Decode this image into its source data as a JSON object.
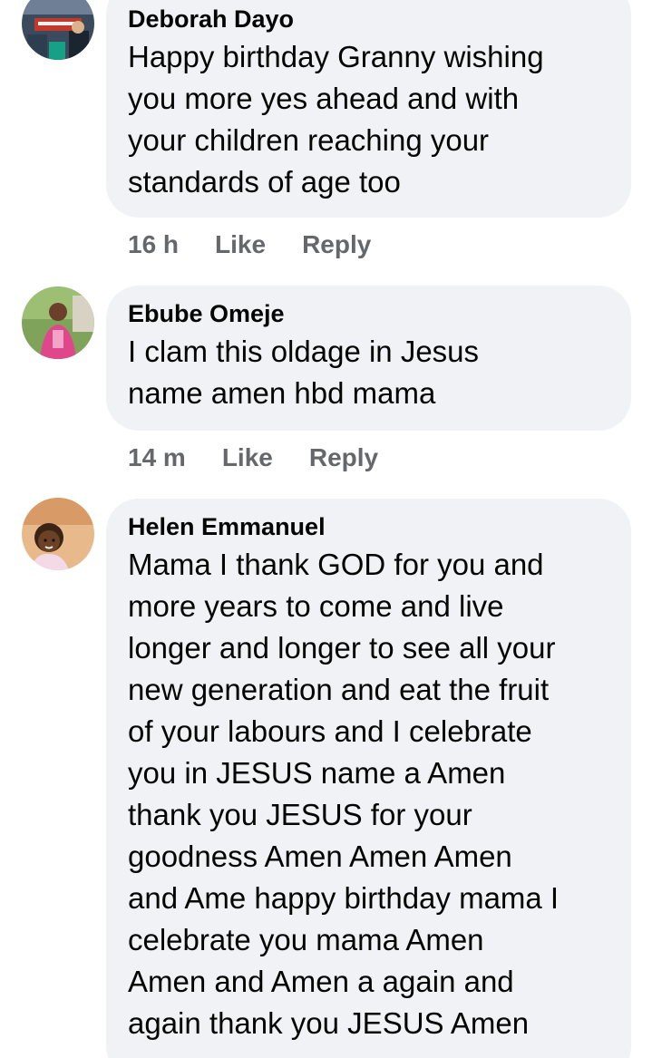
{
  "comments": [
    {
      "author": "Deborah Dayo",
      "lines": [
        "Happy birthday Granny wishing",
        "you more yes ahead and with",
        "your children reaching your",
        "standards of age too"
      ],
      "time": "16 h",
      "like_label": "Like",
      "reply_label": "Reply"
    },
    {
      "author": "Ebube Omeje",
      "lines": [
        "I clam this oldage in Jesus",
        "name amen hbd mama"
      ],
      "time": "14 m",
      "like_label": "Like",
      "reply_label": "Reply"
    },
    {
      "author": "Helen Emmanuel",
      "lines": [
        "Mama I thank GOD for you and",
        "more years to come and live",
        "longer and longer to see all your",
        "new generation and eat the fruit",
        "of your labours and I celebrate",
        "you in JESUS name a Amen",
        "thank you JESUS for your",
        "goodness Amen Amen Amen",
        "and Ame happy birthday mama I",
        "celebrate you mama Amen",
        "Amen and Amen a again and",
        "again thank you JESUS Amen"
      ]
    }
  ],
  "colors": {
    "bubble_background": "#f0f2f5",
    "meta_text": "#65676b",
    "text": "#050505"
  }
}
